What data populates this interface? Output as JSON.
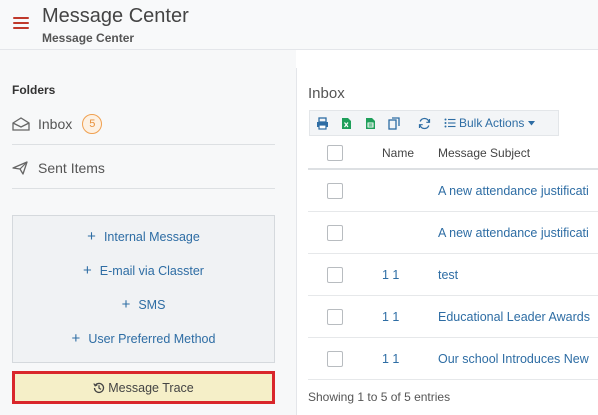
{
  "header": {
    "title": "Message Center",
    "subtitle": "Message Center"
  },
  "sidebar": {
    "folders_label": "Folders",
    "folders": [
      {
        "label": "Inbox",
        "badge": "5",
        "icon": "envelope-open-icon"
      },
      {
        "label": "Sent Items",
        "icon": "paper-plane-icon"
      }
    ],
    "compose": [
      {
        "label": "Internal Message"
      },
      {
        "label": "E-mail via Classter"
      },
      {
        "label": "SMS"
      },
      {
        "label": "User Preferred Method"
      }
    ],
    "trace_label": "Message Trace"
  },
  "main": {
    "title": "Inbox",
    "toolbar": {
      "icons": [
        "print-icon",
        "excel-icon",
        "csv-icon",
        "copy-icon",
        "refresh-icon"
      ],
      "bulk_label": "Bulk Actions"
    },
    "columns": {
      "name": "Name",
      "subject": "Message Subject"
    },
    "rows": [
      {
        "name": "",
        "subject": "A new attendance justificati"
      },
      {
        "name": "",
        "subject": "A new attendance justificati"
      },
      {
        "name": "1 1",
        "subject": "test"
      },
      {
        "name": "1 1",
        "subject": "Educational Leader Awards"
      },
      {
        "name": "1 1",
        "subject": "Our school Introduces New"
      }
    ],
    "footer": "Showing 1 to 5 of 5 entries"
  },
  "colors": {
    "accent": "#2e6da4",
    "hamburger": "#c0392b",
    "highlight_border": "#d9262b",
    "highlight_bg": "#f5efc8",
    "badge": "#e8903a"
  }
}
